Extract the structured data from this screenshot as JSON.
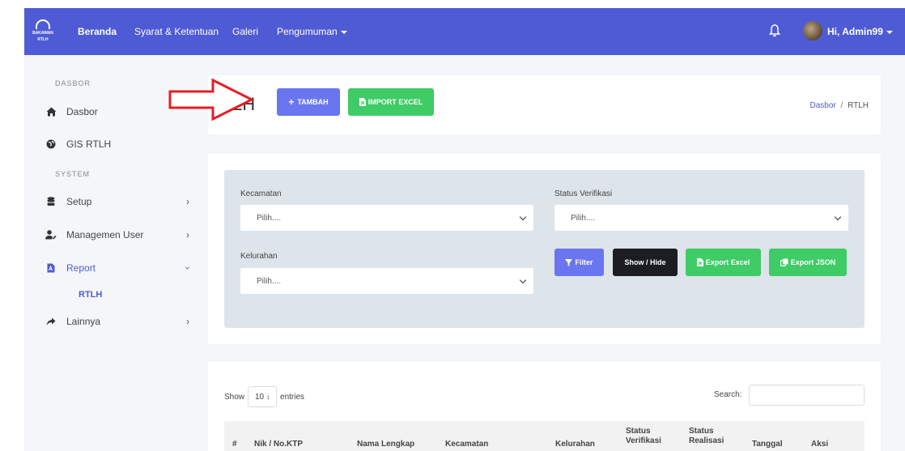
{
  "navbar": {
    "logo_text_line1": "BAKAWAN",
    "logo_text_line2": "RTLH",
    "links": [
      "Beranda",
      "Syarat & Ketentuan",
      "Galeri",
      "Pengumuman"
    ],
    "user_label": "Hi, Admin99",
    "color": "#4f5bd5"
  },
  "sidebar": {
    "section_dasbor": "DASBOR",
    "section_system": "SYSTEM",
    "items": {
      "dasbor": {
        "label": "Dasbor",
        "icon": "home-icon"
      },
      "gis": {
        "label": "GIS RTLH",
        "icon": "globe-icon"
      },
      "setup": {
        "label": "Setup",
        "icon": "database-icon"
      },
      "user": {
        "label": "Managemen User",
        "icon": "user-edit-icon"
      },
      "report": {
        "label": "Report",
        "icon": "file-pdf-icon"
      },
      "report_sub": "RTLH",
      "lainnya": {
        "label": "Lainnya",
        "icon": "share-icon"
      }
    }
  },
  "header": {
    "title": "LH",
    "btn_tambah": "TAMBAH",
    "btn_import": "IMPORT EXCEL",
    "breadcrumb_home": "Dasbor",
    "breadcrumb_sep": "/",
    "breadcrumb_current": "RTLH"
  },
  "filter": {
    "kecamatan_label": "Kecamatan",
    "kecamatan_value": "Pilih....",
    "status_label": "Status Verifikasi",
    "status_value": "Pilih....",
    "kelurahan_label": "Kelurahan",
    "kelurahan_value": "Pilih....",
    "btn_filter": "Filter",
    "btn_showhide": "Show / Hide",
    "btn_export_excel": "Export Excel",
    "btn_export_json": "Export JSON"
  },
  "table": {
    "show_label": "Show",
    "page_length": "10",
    "entries_label": "entries",
    "search_label": "Search:",
    "headers": [
      "#",
      "Nik / No.KTP",
      "Nama Lengkap",
      "Kecamatan",
      "Kelurahan",
      "Status Verifikasi",
      "Status Realisasi",
      "Tanggal",
      "Aksi"
    ]
  }
}
